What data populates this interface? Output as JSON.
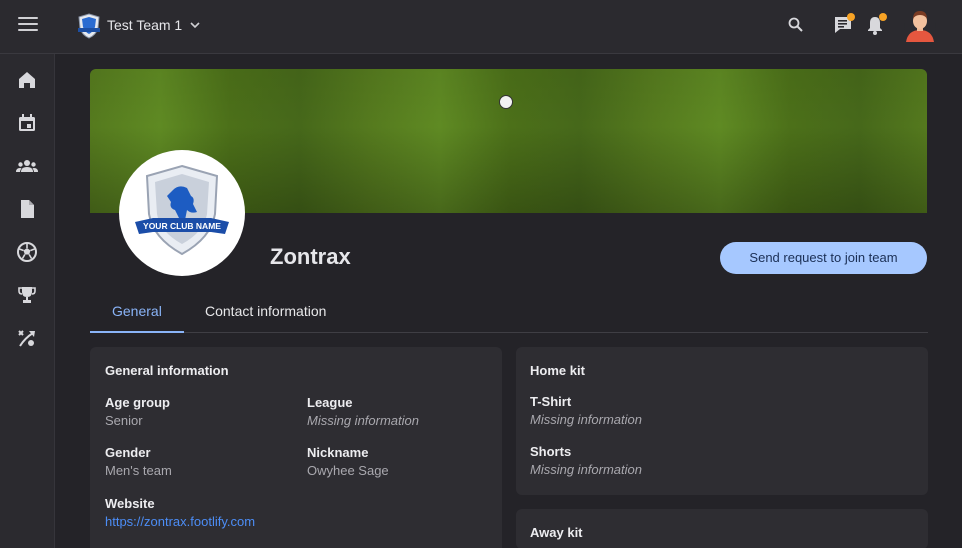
{
  "header": {
    "team_name": "Test Team 1"
  },
  "club": {
    "name": "Zontrax",
    "crest_text": "YOUR CLUB NAME",
    "join_button": "Send request to join team"
  },
  "tabs": [
    {
      "label": "General",
      "active": true
    },
    {
      "label": "Contact information",
      "active": false
    }
  ],
  "general": {
    "title": "General information",
    "age_group_label": "Age group",
    "age_group_value": "Senior",
    "league_label": "League",
    "league_value": "Missing information",
    "gender_label": "Gender",
    "gender_value": "Men's team",
    "nickname_label": "Nickname",
    "nickname_value": "Owyhee Sage",
    "website_label": "Website",
    "website_value": "https://zontrax.footlify.com"
  },
  "home_kit": {
    "title": "Home kit",
    "tshirt_label": "T-Shirt",
    "tshirt_value": "Missing information",
    "shorts_label": "Shorts",
    "shorts_value": "Missing information"
  },
  "away_kit": {
    "title": "Away kit"
  },
  "colors": {
    "accent": "#8ab4f8",
    "button": "#a6c8ff",
    "badge": "#f7a325",
    "link": "#4c8df6"
  },
  "icons": {
    "sidebar": [
      "home-icon",
      "calendar-icon",
      "people-icon",
      "document-icon",
      "soccer-ball-icon",
      "trophy-icon",
      "tactics-icon"
    ],
    "topbar": [
      "menu-icon",
      "search-icon",
      "chat-icon",
      "bell-icon"
    ]
  }
}
